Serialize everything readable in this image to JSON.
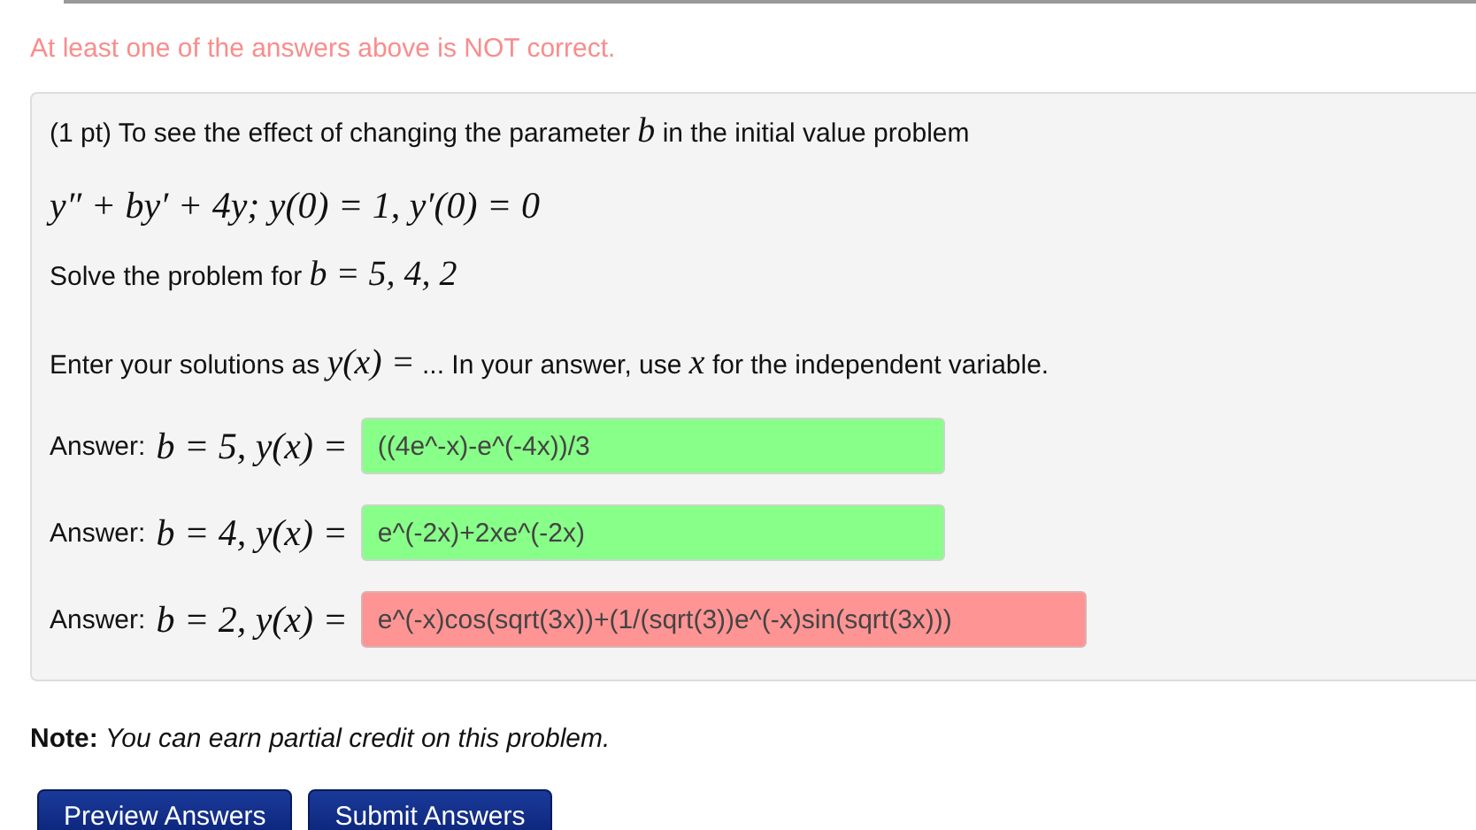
{
  "message": {
    "text": "At least one of the answers above is NOT correct."
  },
  "problem": {
    "paragraphs": [
      {
        "kind": "text",
        "parts": [
          {
            "kind": "text",
            "text": "(1 pt) To see the effect of changing the parameter "
          },
          {
            "kind": "math",
            "text": "b"
          },
          {
            "kind": "text",
            "text": " in the initial value problem"
          }
        ]
      },
      {
        "kind": "equation",
        "parts": [
          {
            "kind": "math",
            "text": "y″ + by′ + 4y; y(0) = 1, y′(0) = 0"
          }
        ]
      },
      {
        "kind": "text",
        "parts": [
          {
            "kind": "text",
            "text": "Solve the problem for "
          },
          {
            "kind": "math",
            "text": "b = 5, 4, 2"
          }
        ]
      },
      {
        "kind": "text",
        "parts": [
          {
            "kind": "text",
            "text": "Enter your solutions as "
          },
          {
            "kind": "math",
            "text": "y(x) ="
          },
          {
            "kind": "text",
            "text": " ... In your answer, use "
          },
          {
            "kind": "math",
            "text": "x"
          },
          {
            "kind": "text",
            "text": " for the independent variable."
          }
        ]
      }
    ],
    "answers": [
      {
        "label": "Answer:",
        "math": "b = 5, y(x) =",
        "value": "((4e^-x)-e^(-4x))/3",
        "correct": true
      },
      {
        "label": "Answer:",
        "math": "b = 4, y(x) =",
        "value": "e^(-2x)+2xe^(-2x)",
        "correct": true
      },
      {
        "label": "Answer:",
        "math": "b = 2, y(x) =",
        "value": "e^(-x)cos(sqrt(3x))+(1/(sqrt(3))e^(-x)sin(sqrt(3x)))",
        "correct": false
      }
    ]
  },
  "note": "**Note:** *You can earn partial credit on this problem.*",
  "buttons": [
    "Preview Answers",
    "Submit Answers"
  ]
}
